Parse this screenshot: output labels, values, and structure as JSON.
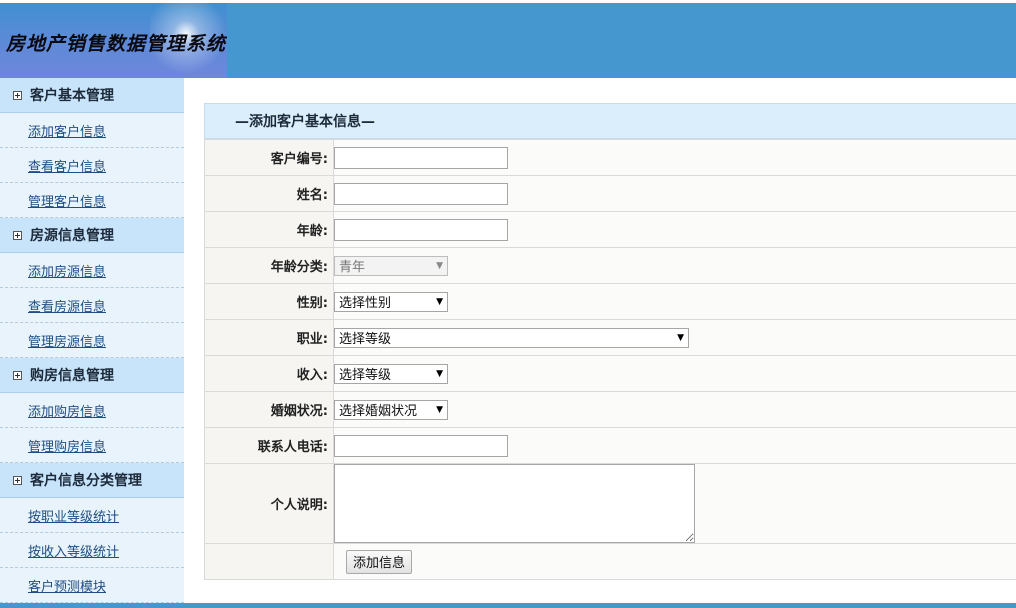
{
  "app": {
    "title": "房地产销售数据管理系统"
  },
  "sidebar": {
    "groups": [
      {
        "label": "客户基本管理",
        "items": [
          "添加客户信息",
          "查看客户信息",
          "管理客户信息"
        ]
      },
      {
        "label": "房源信息管理",
        "items": [
          "添加房源信息",
          "查看房源信息",
          "管理房源信息"
        ]
      },
      {
        "label": "购房信息管理",
        "items": [
          "添加购房信息",
          "管理购房信息"
        ]
      },
      {
        "label": "客户信息分类管理",
        "items": [
          "按职业等级统计",
          "按收入等级统计",
          "客户预测模块"
        ]
      }
    ]
  },
  "form": {
    "title": "—添加客户基本信息—",
    "fields": {
      "customer_id": {
        "label": "客户编号:",
        "value": ""
      },
      "name": {
        "label": "姓名:",
        "value": ""
      },
      "age": {
        "label": "年龄:",
        "value": ""
      },
      "age_category": {
        "label": "年龄分类:",
        "selected": "青年"
      },
      "gender": {
        "label": "性别:",
        "selected": "选择性别"
      },
      "occupation": {
        "label": "职业:",
        "selected": "选择等级"
      },
      "income": {
        "label": "收入:",
        "selected": "选择等级"
      },
      "marital_status": {
        "label": "婚姻状况:",
        "selected": "选择婚姻状况"
      },
      "phone": {
        "label": "联系人电话:",
        "value": ""
      },
      "description": {
        "label": "个人说明:",
        "value": ""
      }
    },
    "submit_label": "添加信息"
  },
  "colors": {
    "header": "#4597cf",
    "sidebar_group": "#c7e4fb",
    "sidebar_item": "#e9f3fb",
    "link": "#1e4e84"
  }
}
